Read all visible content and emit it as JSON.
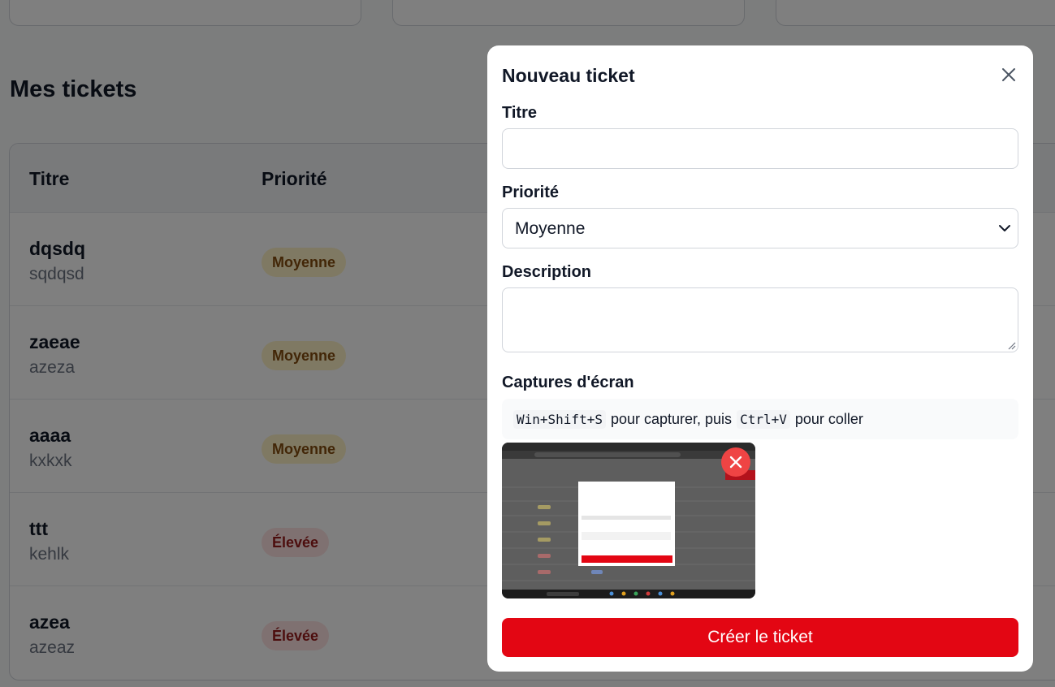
{
  "page": {
    "title": "Mes tickets"
  },
  "table": {
    "headers": {
      "title": "Titre",
      "priority": "Priorité"
    },
    "rows": [
      {
        "title": "dqsdq",
        "description": "sqdqsd",
        "priority": "Moyenne",
        "level": "medium"
      },
      {
        "title": "zaeae",
        "description": "azeza",
        "priority": "Moyenne",
        "level": "medium"
      },
      {
        "title": "aaaa",
        "description": "kxkxk",
        "priority": "Moyenne",
        "level": "medium"
      },
      {
        "title": "ttt",
        "description": "kehlk",
        "priority": "Élevée",
        "level": "high"
      },
      {
        "title": "azea",
        "description": "azeaz",
        "priority": "Élevée",
        "level": "high"
      }
    ]
  },
  "modal": {
    "title": "Nouveau ticket",
    "title_label": "Titre",
    "title_value": "",
    "priority_label": "Priorité",
    "priority_value": "Moyenne",
    "description_label": "Description",
    "description_value": "",
    "screenshots_label": "Captures d'écran",
    "hint": {
      "shortcut_capture": "Win+Shift+S",
      "text_capture": "pour capturer, puis",
      "shortcut_paste": "Ctrl+V",
      "text_paste": "pour coller"
    },
    "submit_label": "Créer le ticket"
  },
  "colors": {
    "accent": "#e30613",
    "remove": "#ef4444",
    "badge_medium_bg": "#fef3c7",
    "badge_high_bg": "#fee2e2"
  }
}
